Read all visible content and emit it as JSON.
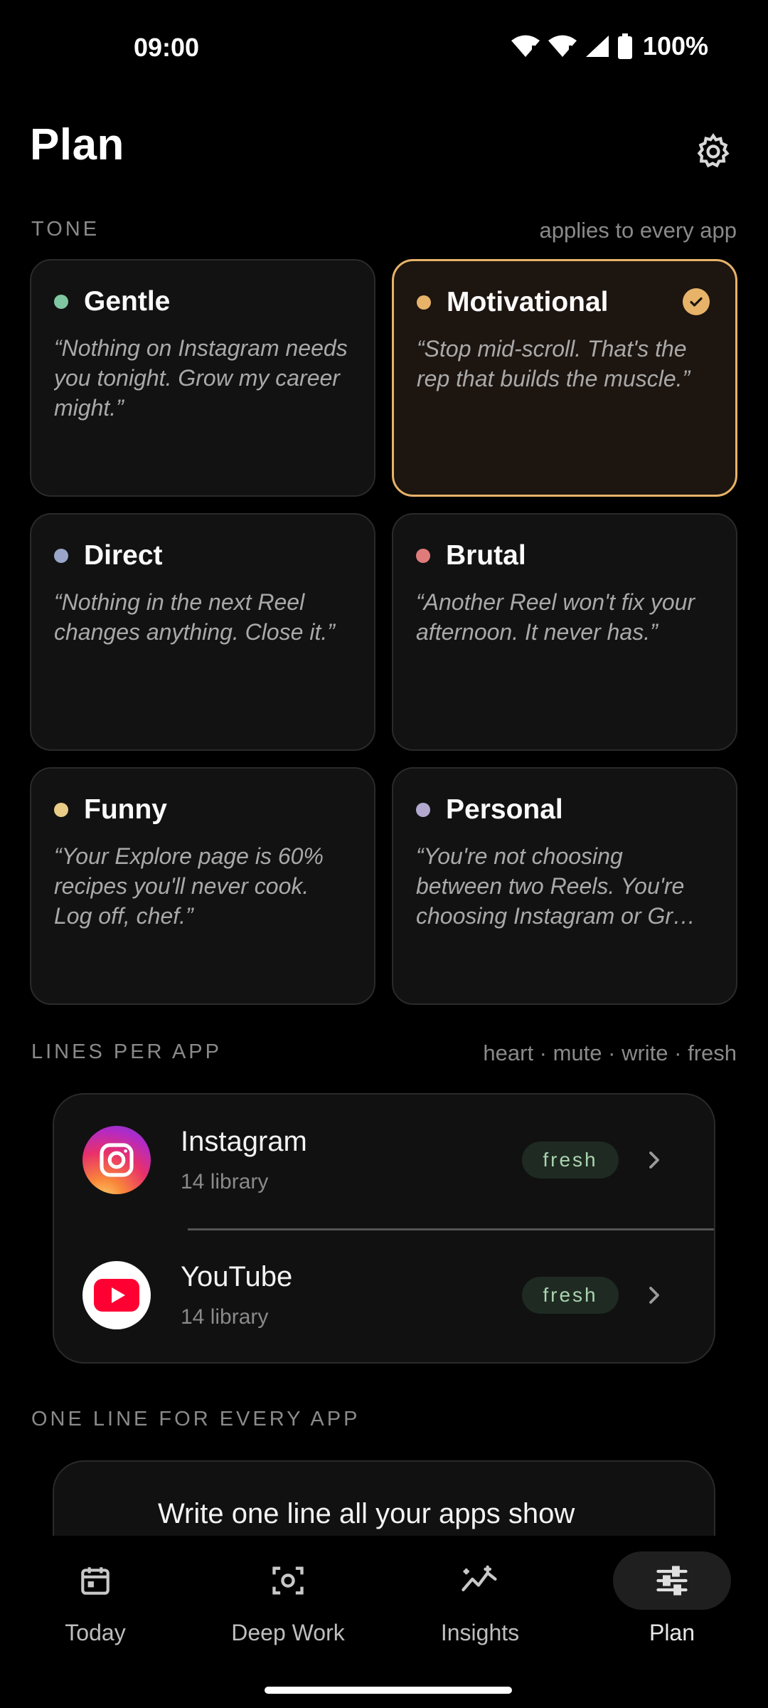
{
  "status_bar": {
    "time": "09:00",
    "battery": "100%"
  },
  "header": {
    "title": "Plan",
    "settings_icon": "gear-icon"
  },
  "tone_section": {
    "label": "TONE",
    "hint": "applies to every app",
    "selected": "Motivational",
    "tones": [
      {
        "name": "Gentle",
        "quote": "“Nothing on Instagram needs you tonight. Grow my career might.”",
        "color": "#7fc7a0"
      },
      {
        "name": "Motivational",
        "quote": "“Stop mid-scroll. That's the rep that builds the muscle.”",
        "color": "#e7b369"
      },
      {
        "name": "Direct",
        "quote": "“Nothing in the next Reel changes anything. Close it.”",
        "color": "#9aa6c9"
      },
      {
        "name": "Brutal",
        "quote": "“Another Reel won't fix your afternoon. It never has.”",
        "color": "#e07b7b"
      },
      {
        "name": "Funny",
        "quote": "“Your Explore page is 60% recipes you'll never cook. Log off, chef.”",
        "color": "#e9cc86"
      },
      {
        "name": "Personal",
        "quote": "“You're not choosing between two Reels. You're choosing Instagram or Gr…",
        "color": "#b3a9cf"
      }
    ]
  },
  "lines_section": {
    "label": "LINES PER APP",
    "hint": "heart · mute · write · fresh",
    "apps": [
      {
        "name": "Instagram",
        "sub": "14 library",
        "badge": "fresh",
        "icon": "instagram-icon"
      },
      {
        "name": "YouTube",
        "sub": "14 library",
        "badge": "fresh",
        "icon": "youtube-icon"
      }
    ]
  },
  "oneline_section": {
    "label": "ONE LINE FOR EVERY APP",
    "text": "Write one line all your apps show first"
  },
  "nav": [
    {
      "label": "Today",
      "icon": "calendar-icon"
    },
    {
      "label": "Deep Work",
      "icon": "focus-icon"
    },
    {
      "label": "Insights",
      "icon": "trend-icon"
    },
    {
      "label": "Plan",
      "icon": "sliders-icon"
    }
  ],
  "nav_active": "Plan"
}
